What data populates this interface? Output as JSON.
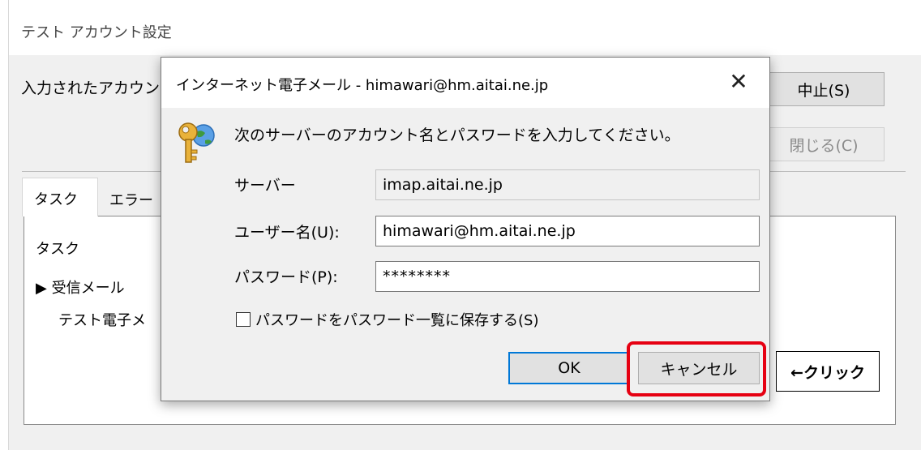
{
  "background_window": {
    "title": "テスト アカウント設定",
    "message": "入力されたアカウント",
    "stop_label": "中止(S)",
    "close_label": "閉じる(C)",
    "tabs": [
      {
        "label": "タスク"
      },
      {
        "label": "エラー"
      }
    ],
    "task_header": "タスク",
    "task_rows": [
      {
        "label": "▶ 受信メール"
      },
      {
        "label": "テスト電子メ"
      }
    ]
  },
  "dialog": {
    "title": "インターネット電子メール - himawari@hm.aitai.ne.jp",
    "close_glyph": "✕",
    "icon": "key-globe-icon",
    "prompt": "次のサーバーのアカウント名とパスワードを入力してください。",
    "server_label": "サーバー",
    "server_value": "imap.aitai.ne.jp",
    "username_label": "ユーザー名(U):",
    "username_value": "himawari@hm.aitai.ne.jp",
    "password_label": "パスワード(P):",
    "password_value": "********",
    "save_password_label": "パスワードをパスワード一覧に保存する(S)",
    "save_password_checked": false,
    "ok_label": "OK",
    "cancel_label": "キャンセル"
  },
  "annotation": {
    "callout_text": "←クリック",
    "highlight_color": "#e60012"
  },
  "colors": {
    "dialog_bg": "#f0f0f0",
    "default_button_border": "#0078d7"
  }
}
